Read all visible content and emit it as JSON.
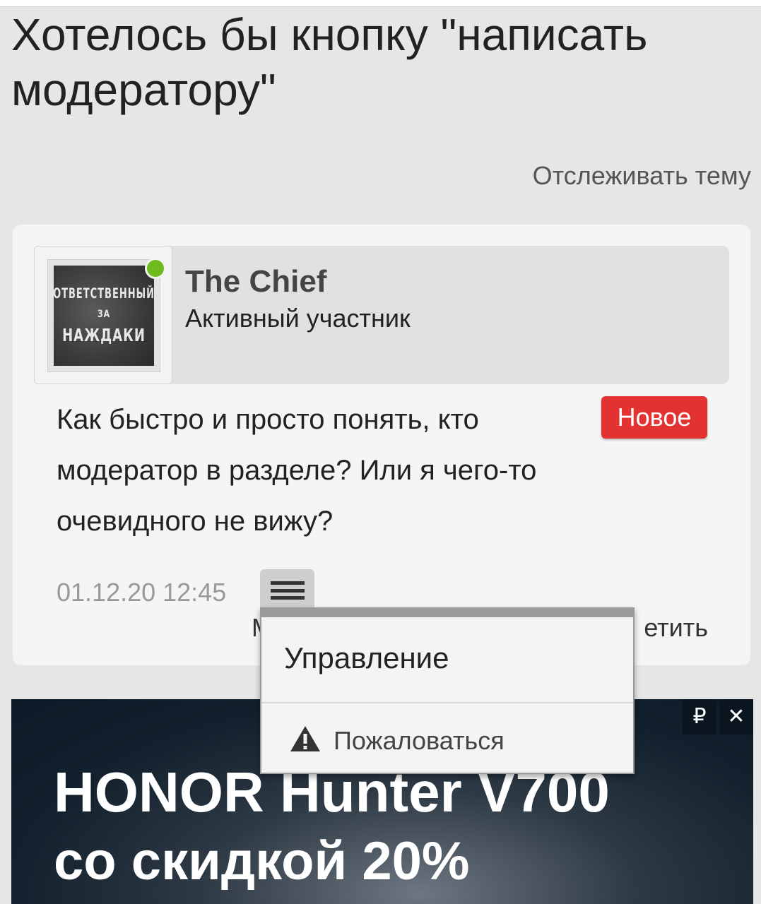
{
  "topic": {
    "title": "Хотелось бы кнопку \"написать модератору\"",
    "watch_label": "Отслеживать тему"
  },
  "post": {
    "author": {
      "name": "The Chief",
      "role": "Активный участник",
      "online": true,
      "avatar_text": [
        "ОТВЕТСТВЕННЫЙ",
        "ЗА",
        "НАЖДАКИ"
      ]
    },
    "body": "Как быстро и просто понять, кто модератор в разделе? Или я чего-то очевидного не вижу?",
    "badge": "Новое",
    "date": "01.12.20 12:45",
    "reply_hint_left": "М",
    "reply_hint_right": "етить"
  },
  "post_menu": {
    "items": [
      {
        "label": "Управление",
        "icon": ""
      },
      {
        "label": "Пожаловаться",
        "icon": "warning-icon"
      }
    ]
  },
  "ad": {
    "title": "HONOR Hunter V700",
    "subtitle": "со скидкой 20%",
    "ruble_label": "₽",
    "close_label": "✕"
  },
  "colors": {
    "background": "#e6e6e6",
    "card": "#f5f5f5",
    "badge": "#e33232",
    "online": "#6fba1f"
  }
}
